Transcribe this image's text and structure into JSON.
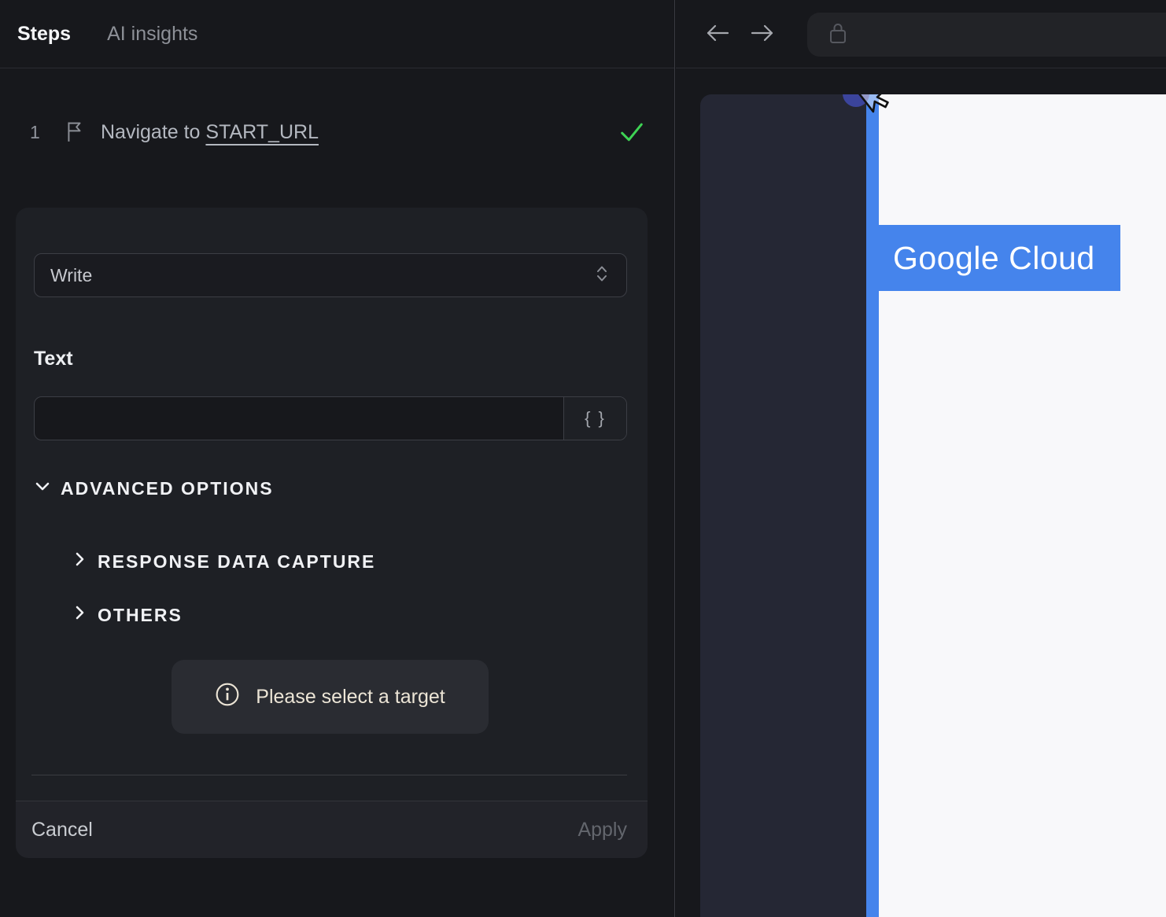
{
  "panel": {
    "tabs": {
      "steps": "Steps",
      "ai_insights": "AI insights"
    },
    "step": {
      "number": "1",
      "text": "Navigate to ",
      "link_text": "START_URL"
    }
  },
  "editor": {
    "action_value": "Write",
    "text_label": "Text",
    "input_value": "",
    "input_placeholder": "",
    "variable_button_label": "{ }",
    "advanced_options": "ADVANCED OPTIONS",
    "sections": {
      "response_data_capture": "RESPONSE DATA CAPTURE",
      "others": "OTHERS"
    },
    "notice": "Please select a target",
    "cancel": "Cancel",
    "apply": "Apply"
  },
  "browser": {
    "page_highlight_label": "Google Cloud"
  },
  "colors": {
    "accent_blue": "#4584ec",
    "success_green": "#3ed354",
    "notice_text": "#ece5d6",
    "panel_bg": "#17181c",
    "card_bg": "#1e2025",
    "page_dark": "#252734",
    "page_white": "#f8f8fa"
  }
}
